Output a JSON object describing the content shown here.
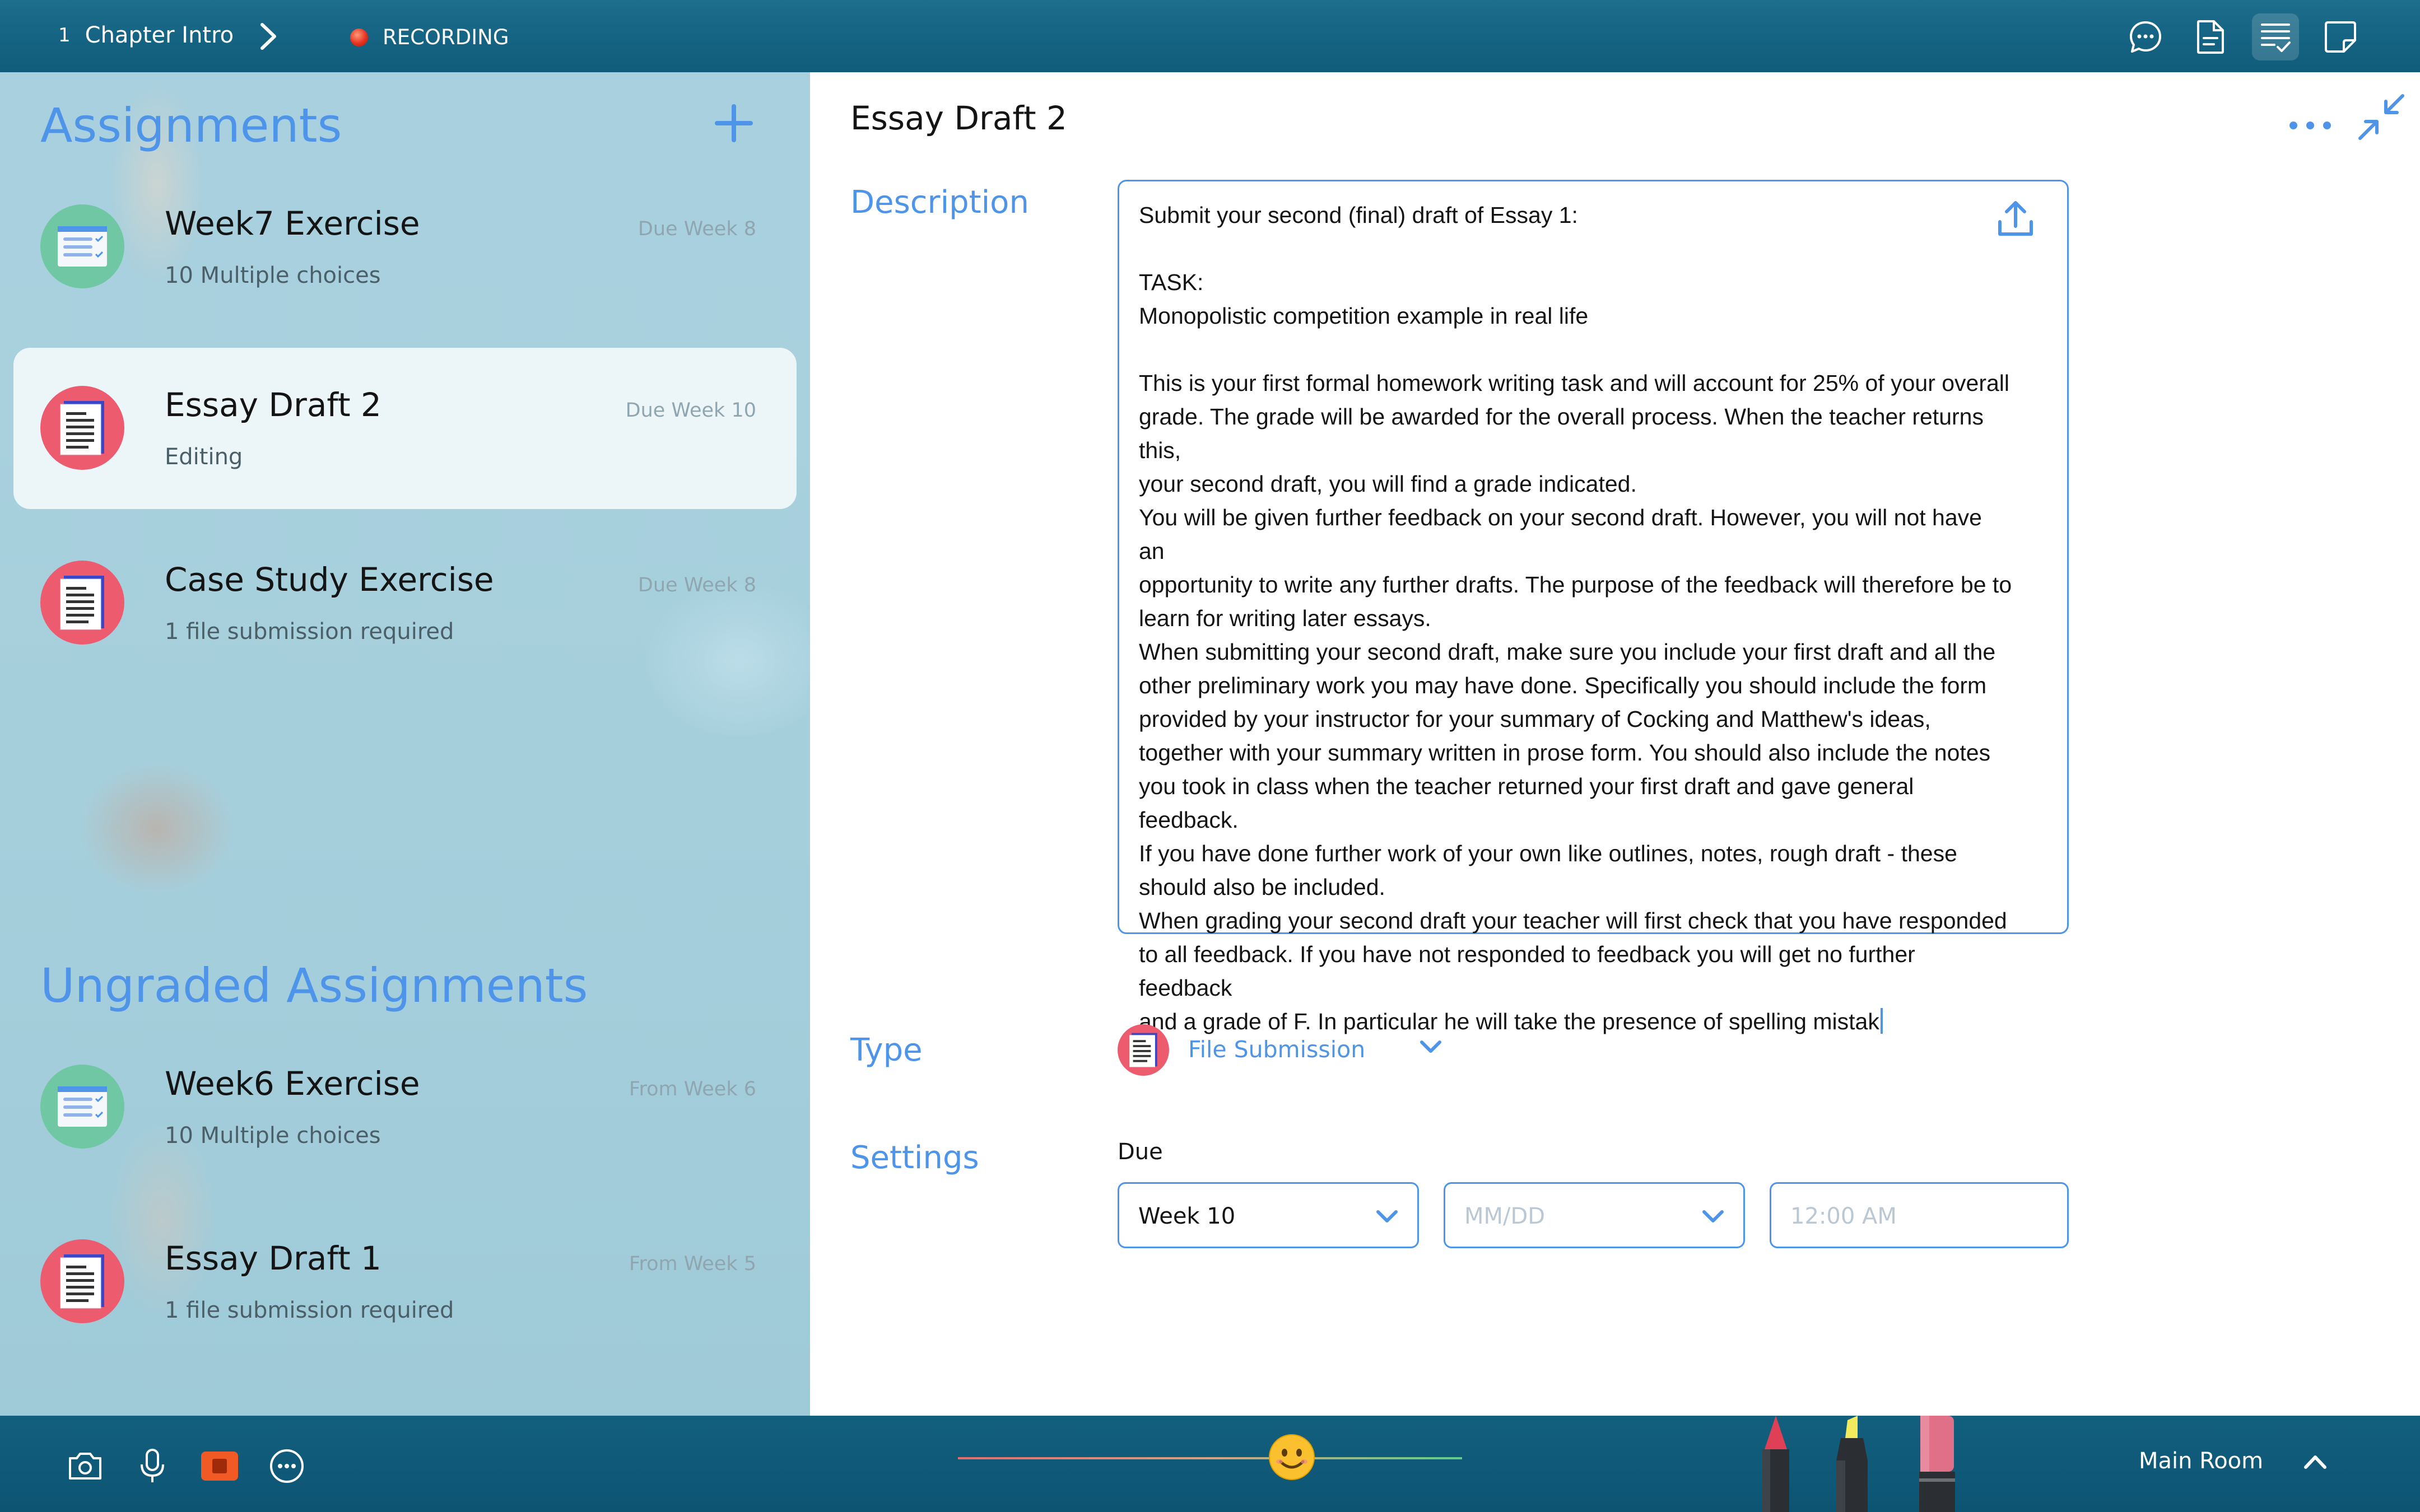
{
  "topbar": {
    "chapter_number": "1",
    "chapter_title": "Chapter Intro",
    "recording_label": "RECORDING",
    "icons": [
      "chat-icon",
      "document-icon",
      "checklist-icon",
      "sticky-note-icon"
    ],
    "active_icon": "checklist-icon"
  },
  "sidebar": {
    "assignments_title": "Assignments",
    "ungraded_title": "Ungraded Assignments",
    "assignments": [
      {
        "title": "Week7 Exercise",
        "subtitle": "10 Multiple choices",
        "due": "Due Week 8",
        "icon": "quiz-icon",
        "selected": false
      },
      {
        "title": "Essay Draft 2",
        "subtitle": "Editing",
        "due": "Due Week 10",
        "icon": "file-icon",
        "selected": true
      },
      {
        "title": "Case Study Exercise",
        "subtitle": "1 file submission required",
        "due": "Due Week 8",
        "icon": "file-icon",
        "selected": false
      }
    ],
    "ungraded": [
      {
        "title": "Week6 Exercise",
        "subtitle": "10 Multiple choices",
        "due": "From Week 6",
        "icon": "quiz-icon"
      },
      {
        "title": "Essay Draft 1",
        "subtitle": "1 file submission required",
        "due": "From Week 5",
        "icon": "file-icon"
      }
    ]
  },
  "editor": {
    "title": "Essay Draft 2",
    "description_label": "Description",
    "description_text": "Submit your second (final) draft of Essay 1:\n\nTASK:\nMonopolistic competition example in real life\n\nThis is your first formal homework writing task and will account for 25% of your overall\ngrade. The grade will be awarded for the overall process. When the teacher returns this,\nyour second draft, you will find a grade indicated.\nYou will be given further feedback on your second draft. However, you will not have an\nopportunity to write any further drafts. The purpose of the feedback will therefore be to\nlearn for writing later essays.\nWhen submitting your second draft, make sure you include your first draft and all the\nother preliminary work you may have done. Specifically you should include the form\nprovided by your instructor for your summary of Cocking and Matthew's ideas,\ntogether with your summary written in prose form. You should also include the notes\nyou took in class when the teacher returned your first draft and gave general feedback.\nIf you have done further work of your own like outlines, notes, rough draft - these\nshould also be included.\nWhen grading your second draft your teacher will first check that you have responded\nto all feedback. If you have not responded to feedback you will get no further feedback\nand a grade of F. In particular he will take the presence of spelling mistak",
    "type_label": "Type",
    "type_value": "File Submission",
    "settings_label": "Settings",
    "due_label": "Due",
    "due_week": "Week 10",
    "date_placeholder": "MM/DD",
    "time_placeholder": "12:00 AM"
  },
  "bottombar": {
    "room_label": "Main Room",
    "icons": [
      "camera-icon",
      "microphone-icon",
      "record-stop-icon",
      "more-icon"
    ],
    "reaction_icon": "smiley-icon",
    "tools": [
      "red-pen",
      "yellow-highlighter",
      "pink-marker"
    ]
  },
  "colors": {
    "accent": "#4e95ea",
    "topbar": "#15617f",
    "sidebar": "#a8cfdc",
    "selected_item": "#eef4f6"
  }
}
